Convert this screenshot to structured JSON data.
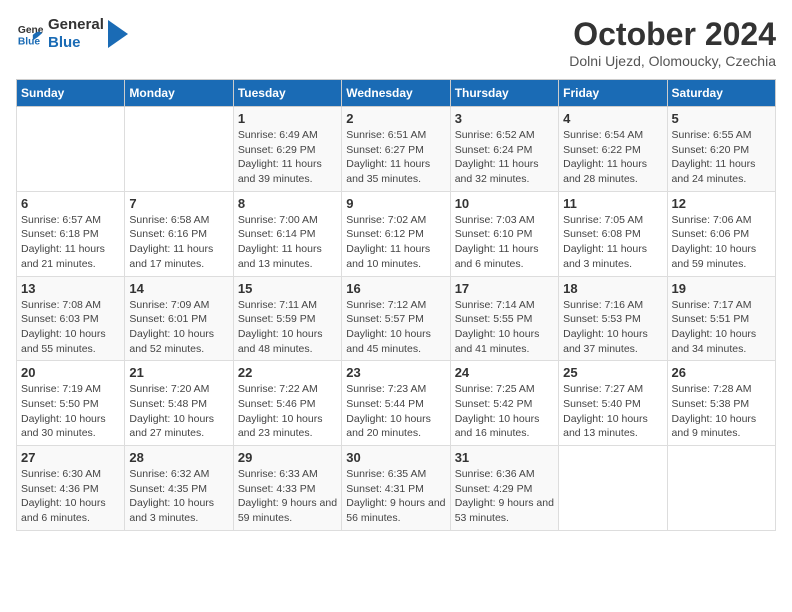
{
  "header": {
    "logo_general": "General",
    "logo_blue": "Blue",
    "month_title": "October 2024",
    "subtitle": "Dolni Ujezd, Olomoucky, Czechia"
  },
  "days_of_week": [
    "Sunday",
    "Monday",
    "Tuesday",
    "Wednesday",
    "Thursday",
    "Friday",
    "Saturday"
  ],
  "weeks": [
    [
      {
        "day": "",
        "details": ""
      },
      {
        "day": "",
        "details": ""
      },
      {
        "day": "1",
        "details": "Sunrise: 6:49 AM\nSunset: 6:29 PM\nDaylight: 11 hours and 39 minutes."
      },
      {
        "day": "2",
        "details": "Sunrise: 6:51 AM\nSunset: 6:27 PM\nDaylight: 11 hours and 35 minutes."
      },
      {
        "day": "3",
        "details": "Sunrise: 6:52 AM\nSunset: 6:24 PM\nDaylight: 11 hours and 32 minutes."
      },
      {
        "day": "4",
        "details": "Sunrise: 6:54 AM\nSunset: 6:22 PM\nDaylight: 11 hours and 28 minutes."
      },
      {
        "day": "5",
        "details": "Sunrise: 6:55 AM\nSunset: 6:20 PM\nDaylight: 11 hours and 24 minutes."
      }
    ],
    [
      {
        "day": "6",
        "details": "Sunrise: 6:57 AM\nSunset: 6:18 PM\nDaylight: 11 hours and 21 minutes."
      },
      {
        "day": "7",
        "details": "Sunrise: 6:58 AM\nSunset: 6:16 PM\nDaylight: 11 hours and 17 minutes."
      },
      {
        "day": "8",
        "details": "Sunrise: 7:00 AM\nSunset: 6:14 PM\nDaylight: 11 hours and 13 minutes."
      },
      {
        "day": "9",
        "details": "Sunrise: 7:02 AM\nSunset: 6:12 PM\nDaylight: 11 hours and 10 minutes."
      },
      {
        "day": "10",
        "details": "Sunrise: 7:03 AM\nSunset: 6:10 PM\nDaylight: 11 hours and 6 minutes."
      },
      {
        "day": "11",
        "details": "Sunrise: 7:05 AM\nSunset: 6:08 PM\nDaylight: 11 hours and 3 minutes."
      },
      {
        "day": "12",
        "details": "Sunrise: 7:06 AM\nSunset: 6:06 PM\nDaylight: 10 hours and 59 minutes."
      }
    ],
    [
      {
        "day": "13",
        "details": "Sunrise: 7:08 AM\nSunset: 6:03 PM\nDaylight: 10 hours and 55 minutes."
      },
      {
        "day": "14",
        "details": "Sunrise: 7:09 AM\nSunset: 6:01 PM\nDaylight: 10 hours and 52 minutes."
      },
      {
        "day": "15",
        "details": "Sunrise: 7:11 AM\nSunset: 5:59 PM\nDaylight: 10 hours and 48 minutes."
      },
      {
        "day": "16",
        "details": "Sunrise: 7:12 AM\nSunset: 5:57 PM\nDaylight: 10 hours and 45 minutes."
      },
      {
        "day": "17",
        "details": "Sunrise: 7:14 AM\nSunset: 5:55 PM\nDaylight: 10 hours and 41 minutes."
      },
      {
        "day": "18",
        "details": "Sunrise: 7:16 AM\nSunset: 5:53 PM\nDaylight: 10 hours and 37 minutes."
      },
      {
        "day": "19",
        "details": "Sunrise: 7:17 AM\nSunset: 5:51 PM\nDaylight: 10 hours and 34 minutes."
      }
    ],
    [
      {
        "day": "20",
        "details": "Sunrise: 7:19 AM\nSunset: 5:50 PM\nDaylight: 10 hours and 30 minutes."
      },
      {
        "day": "21",
        "details": "Sunrise: 7:20 AM\nSunset: 5:48 PM\nDaylight: 10 hours and 27 minutes."
      },
      {
        "day": "22",
        "details": "Sunrise: 7:22 AM\nSunset: 5:46 PM\nDaylight: 10 hours and 23 minutes."
      },
      {
        "day": "23",
        "details": "Sunrise: 7:23 AM\nSunset: 5:44 PM\nDaylight: 10 hours and 20 minutes."
      },
      {
        "day": "24",
        "details": "Sunrise: 7:25 AM\nSunset: 5:42 PM\nDaylight: 10 hours and 16 minutes."
      },
      {
        "day": "25",
        "details": "Sunrise: 7:27 AM\nSunset: 5:40 PM\nDaylight: 10 hours and 13 minutes."
      },
      {
        "day": "26",
        "details": "Sunrise: 7:28 AM\nSunset: 5:38 PM\nDaylight: 10 hours and 9 minutes."
      }
    ],
    [
      {
        "day": "27",
        "details": "Sunrise: 6:30 AM\nSunset: 4:36 PM\nDaylight: 10 hours and 6 minutes."
      },
      {
        "day": "28",
        "details": "Sunrise: 6:32 AM\nSunset: 4:35 PM\nDaylight: 10 hours and 3 minutes."
      },
      {
        "day": "29",
        "details": "Sunrise: 6:33 AM\nSunset: 4:33 PM\nDaylight: 9 hours and 59 minutes."
      },
      {
        "day": "30",
        "details": "Sunrise: 6:35 AM\nSunset: 4:31 PM\nDaylight: 9 hours and 56 minutes."
      },
      {
        "day": "31",
        "details": "Sunrise: 6:36 AM\nSunset: 4:29 PM\nDaylight: 9 hours and 53 minutes."
      },
      {
        "day": "",
        "details": ""
      },
      {
        "day": "",
        "details": ""
      }
    ]
  ]
}
